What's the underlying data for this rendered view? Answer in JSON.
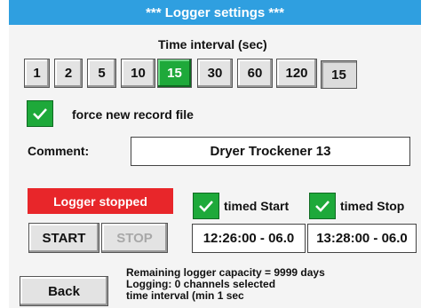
{
  "title": "***   Logger settings   ***",
  "time_interval": {
    "label": "Time interval (sec)",
    "options": [
      "1",
      "2",
      "5",
      "10",
      "15",
      "30",
      "60",
      "120"
    ],
    "selected": "15",
    "current_value": "15"
  },
  "force_new_file": {
    "checked": true,
    "label": "force new record file"
  },
  "comment": {
    "label": "Comment:",
    "value": "Dryer Trockener 13"
  },
  "logger": {
    "status": "Logger stopped",
    "start_label": "START",
    "stop_label": "STOP"
  },
  "timed_start": {
    "checked": true,
    "label": "timed Start",
    "value": "12:26:00 - 06.0"
  },
  "timed_stop": {
    "checked": true,
    "label": "timed Stop",
    "value": "13:28:00 - 06.0"
  },
  "back_label": "Back",
  "info_lines": [
    "Remaining logger capacity = 9999 days",
    "Logging: 0 channels selected",
    "time interval (min 1 sec"
  ],
  "colors": {
    "title_bar": "#2f9fe0",
    "active_green": "#1ea93a",
    "stopped_red": "#e8262a"
  },
  "icons": {
    "checkbox": "checkmark-icon"
  }
}
